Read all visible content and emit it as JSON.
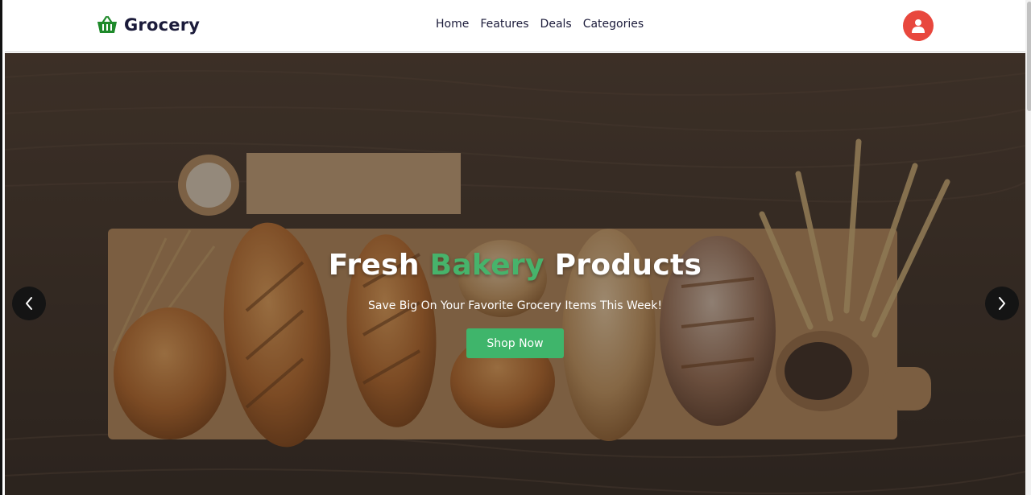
{
  "header": {
    "brand": "Grocery",
    "nav": [
      {
        "label": "Home"
      },
      {
        "label": "Features"
      },
      {
        "label": "Deals"
      },
      {
        "label": "Categories"
      }
    ],
    "avatar_icon": "user-icon"
  },
  "hero": {
    "title_part1": "Fresh",
    "title_accent": "Bakery",
    "title_part2": "Products",
    "subtitle": "Save Big On Your Favorite Grocery Items This Week!",
    "cta_label": "Shop Now",
    "prev_icon": "chevron-left-icon",
    "next_icon": "chevron-right-icon"
  },
  "colors": {
    "brand_green": "#1f8a2b",
    "accent_green": "#47b36b",
    "button_green": "#3fb56b",
    "avatar_red": "#e8473d",
    "text_dark": "#1b1b3a"
  }
}
